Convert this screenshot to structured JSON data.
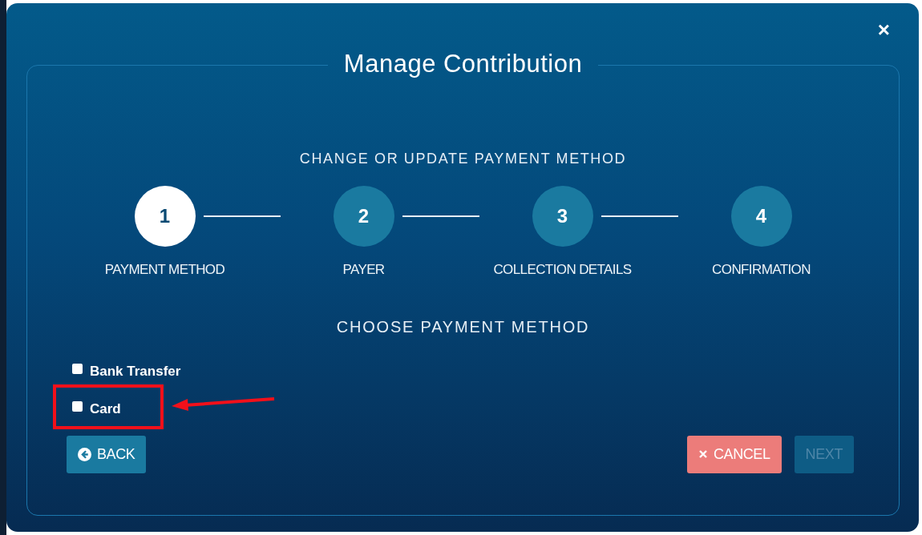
{
  "dialog": {
    "title": "Manage Contribution",
    "close": "×"
  },
  "subtitle": "CHANGE OR UPDATE PAYMENT METHOD",
  "steps": [
    {
      "number": "1",
      "label": "PAYMENT METHOD",
      "selected": true
    },
    {
      "number": "2",
      "label": "PAYER",
      "selected": false
    },
    {
      "number": "3",
      "label": "COLLECTION DETAILS",
      "selected": false
    },
    {
      "number": "4",
      "label": "CONFIRMATION",
      "selected": false
    }
  ],
  "section_title": "CHOOSE PAYMENT METHOD",
  "options": [
    {
      "label": "Bank Transfer",
      "checked": false,
      "highlighted": false
    },
    {
      "label": "Card",
      "checked": false,
      "highlighted": true
    }
  ],
  "buttons": [
    {
      "kind": "back",
      "label": "BACK",
      "disabled": false
    },
    {
      "kind": "cancel",
      "label": "CANCEL",
      "disabled": false
    },
    {
      "kind": "next",
      "label": "NEXT",
      "disabled": true
    }
  ]
}
